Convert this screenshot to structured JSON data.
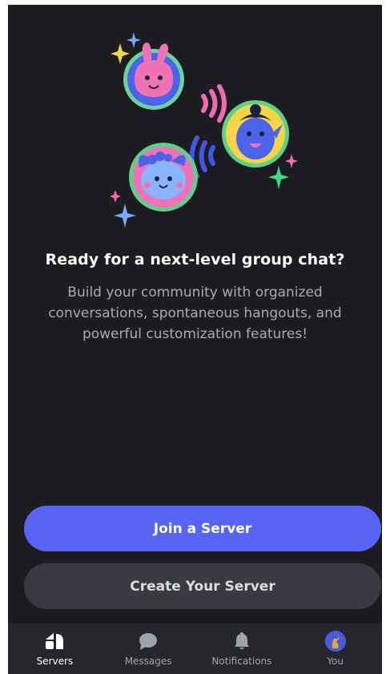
{
  "main": {
    "headline": "Ready for a next-level group chat?",
    "subtext": "Build your community with organized conversations, spontaneous hangouts, and powerful customization features!"
  },
  "actions": {
    "join_label": "Join a Server",
    "create_label": "Create Your Server"
  },
  "tabs": [
    {
      "label": "Servers",
      "icon": "servers-icon",
      "active": true
    },
    {
      "label": "Messages",
      "icon": "chat-bubble-icon",
      "active": false
    },
    {
      "label": "Notifications",
      "icon": "bell-icon",
      "active": false
    },
    {
      "label": "You",
      "icon": "avatar",
      "active": false
    }
  ],
  "colors": {
    "background": "#1c1c21",
    "primary": "#5865f2",
    "secondary_button": "#3a3b42",
    "tabbar": "#26272c"
  }
}
